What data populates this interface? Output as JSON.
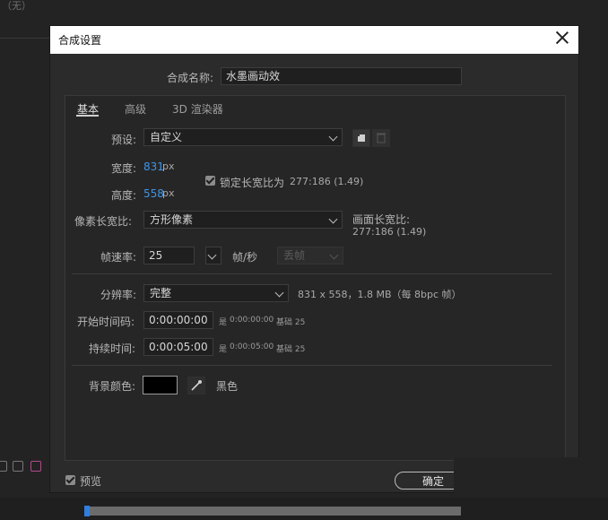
{
  "background": {
    "top_label": "（无）"
  },
  "dialog": {
    "title": "合成设置",
    "comp_name_label": "合成名称:",
    "comp_name_value": "水墨画动效",
    "tabs": [
      "基本",
      "高级",
      "3D 渲染器"
    ],
    "preset_label": "预设:",
    "preset_value": "自定义",
    "width_label": "宽度:",
    "width_value": "831",
    "width_unit": "px",
    "height_label": "高度:",
    "height_value": "558",
    "height_unit": "px",
    "lock_aspect_label": "锁定长宽比为",
    "lock_aspect_value": "277:186 (1.49)",
    "lock_aspect_checked": true,
    "pixel_aspect_label": "像素长宽比:",
    "pixel_aspect_value": "方形像素",
    "frame_aspect_label": "画面长宽比:",
    "frame_aspect_value": "277:186 (1.49)",
    "frame_rate_label": "帧速率:",
    "frame_rate_value": "25",
    "frame_rate_unit": "帧/秒",
    "drop_frame_value": "丢帧",
    "resolution_label": "分辨率:",
    "resolution_value": "完整",
    "resolution_info": "831 x 558，1.8 MB（每 8bpc 帧）",
    "start_tc_label": "开始时间码:",
    "start_tc_value": "0:00:00:00",
    "start_tc_info_prefix": "是",
    "start_tc_info_value": "0:00:00:00",
    "start_tc_base": "基础 25",
    "duration_label": "持续时间:",
    "duration_value": "0:00:05:00",
    "duration_info_prefix": "是",
    "duration_info_value": "0:00:05:00",
    "duration_base": "基础 25",
    "bg_color_label": "背景颜色:",
    "bg_color_name": "黑色",
    "bg_color_hex": "#000000",
    "preview_label": "预览",
    "preview_checked": true,
    "ok_label": "确定"
  }
}
